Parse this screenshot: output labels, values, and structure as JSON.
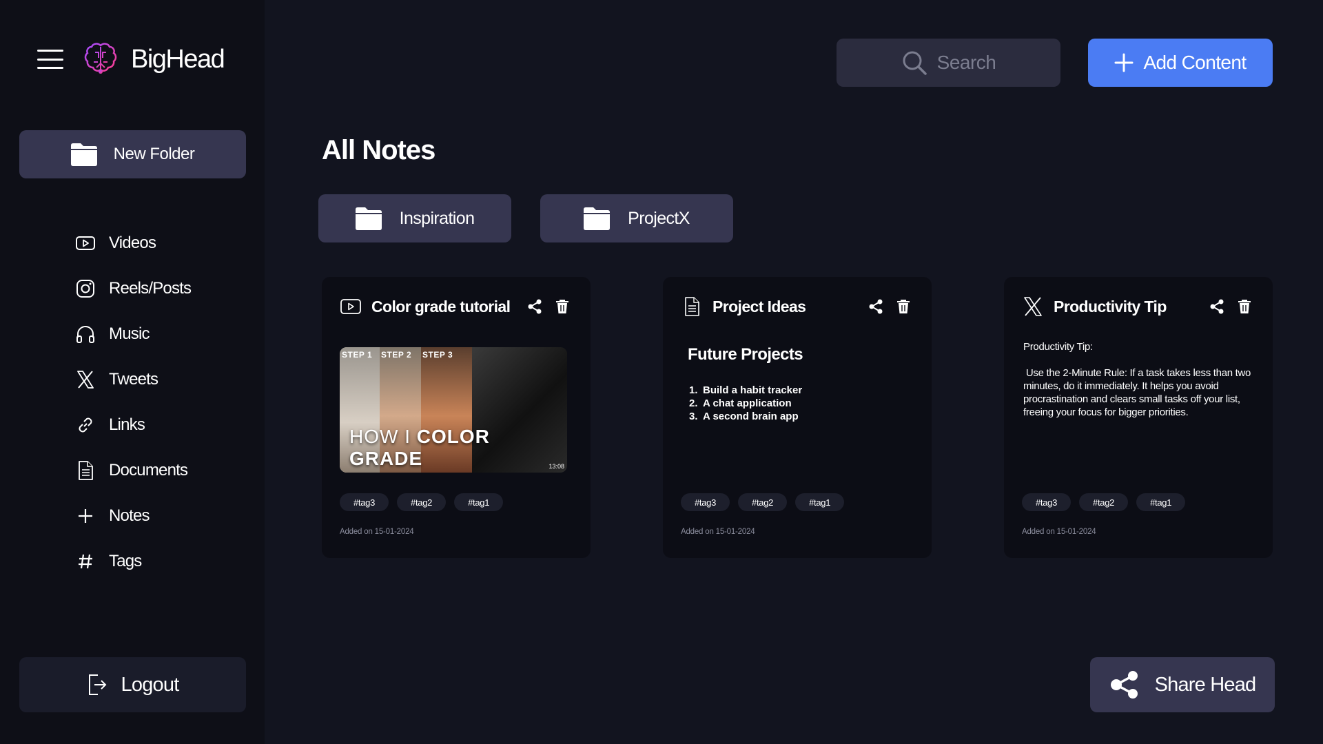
{
  "brand": {
    "name": "BigHead",
    "logo_icon": "brain-icon",
    "logo_gradient": [
      "#a14bff",
      "#ff3c8c"
    ]
  },
  "sidebar": {
    "new_folder_label": "New Folder",
    "items": [
      {
        "label": "Videos",
        "icon": "video-play-icon"
      },
      {
        "label": "Reels/Posts",
        "icon": "instagram-icon"
      },
      {
        "label": "Music",
        "icon": "headphones-icon"
      },
      {
        "label": "Tweets",
        "icon": "x-logo-icon"
      },
      {
        "label": "Links",
        "icon": "link-icon"
      },
      {
        "label": "Documents",
        "icon": "document-icon"
      },
      {
        "label": "Notes",
        "icon": "plus-icon"
      },
      {
        "label": "Tags",
        "icon": "hash-icon"
      }
    ],
    "logout_label": "Logout"
  },
  "header": {
    "search_placeholder": "Search",
    "add_content_label": "Add Content",
    "accent": "#4b7cf3"
  },
  "main": {
    "title": "All Notes",
    "folders": [
      {
        "label": "Inspiration"
      },
      {
        "label": "ProjectX"
      }
    ],
    "cards": [
      {
        "type_icon": "video-play-icon",
        "title": "Color grade tutorial",
        "thumbnail": {
          "steps": [
            "STEP 1",
            "STEP 2",
            "STEP 3"
          ],
          "caption_light": "HOW I ",
          "caption_bold": "COLOR GRADE",
          "duration": "13:08"
        },
        "tags": [
          "#tag3",
          "#tag2",
          "#tag1"
        ],
        "added": "Added on 15-01-2024"
      },
      {
        "type_icon": "document-icon",
        "title": "Project Ideas",
        "heading": "Future Projects",
        "list": [
          "Build a habit tracker",
          "A chat application",
          "A second brain app"
        ],
        "tags": [
          "#tag3",
          "#tag2",
          "#tag1"
        ],
        "added": "Added on 15-01-2024"
      },
      {
        "type_icon": "x-logo-icon",
        "title": "Productivity Tip",
        "paragraphs": [
          "Productivity Tip:",
          " Use the 2-Minute Rule: If a task takes less than two minutes, do it immediately. It helps you avoid procrastination and clears small tasks off your list, freeing your focus for bigger priorities."
        ],
        "tags": [
          "#tag3",
          "#tag2",
          "#tag1"
        ],
        "added": "Added on 15-01-2024"
      }
    ]
  },
  "share_head_label": "Share Head"
}
